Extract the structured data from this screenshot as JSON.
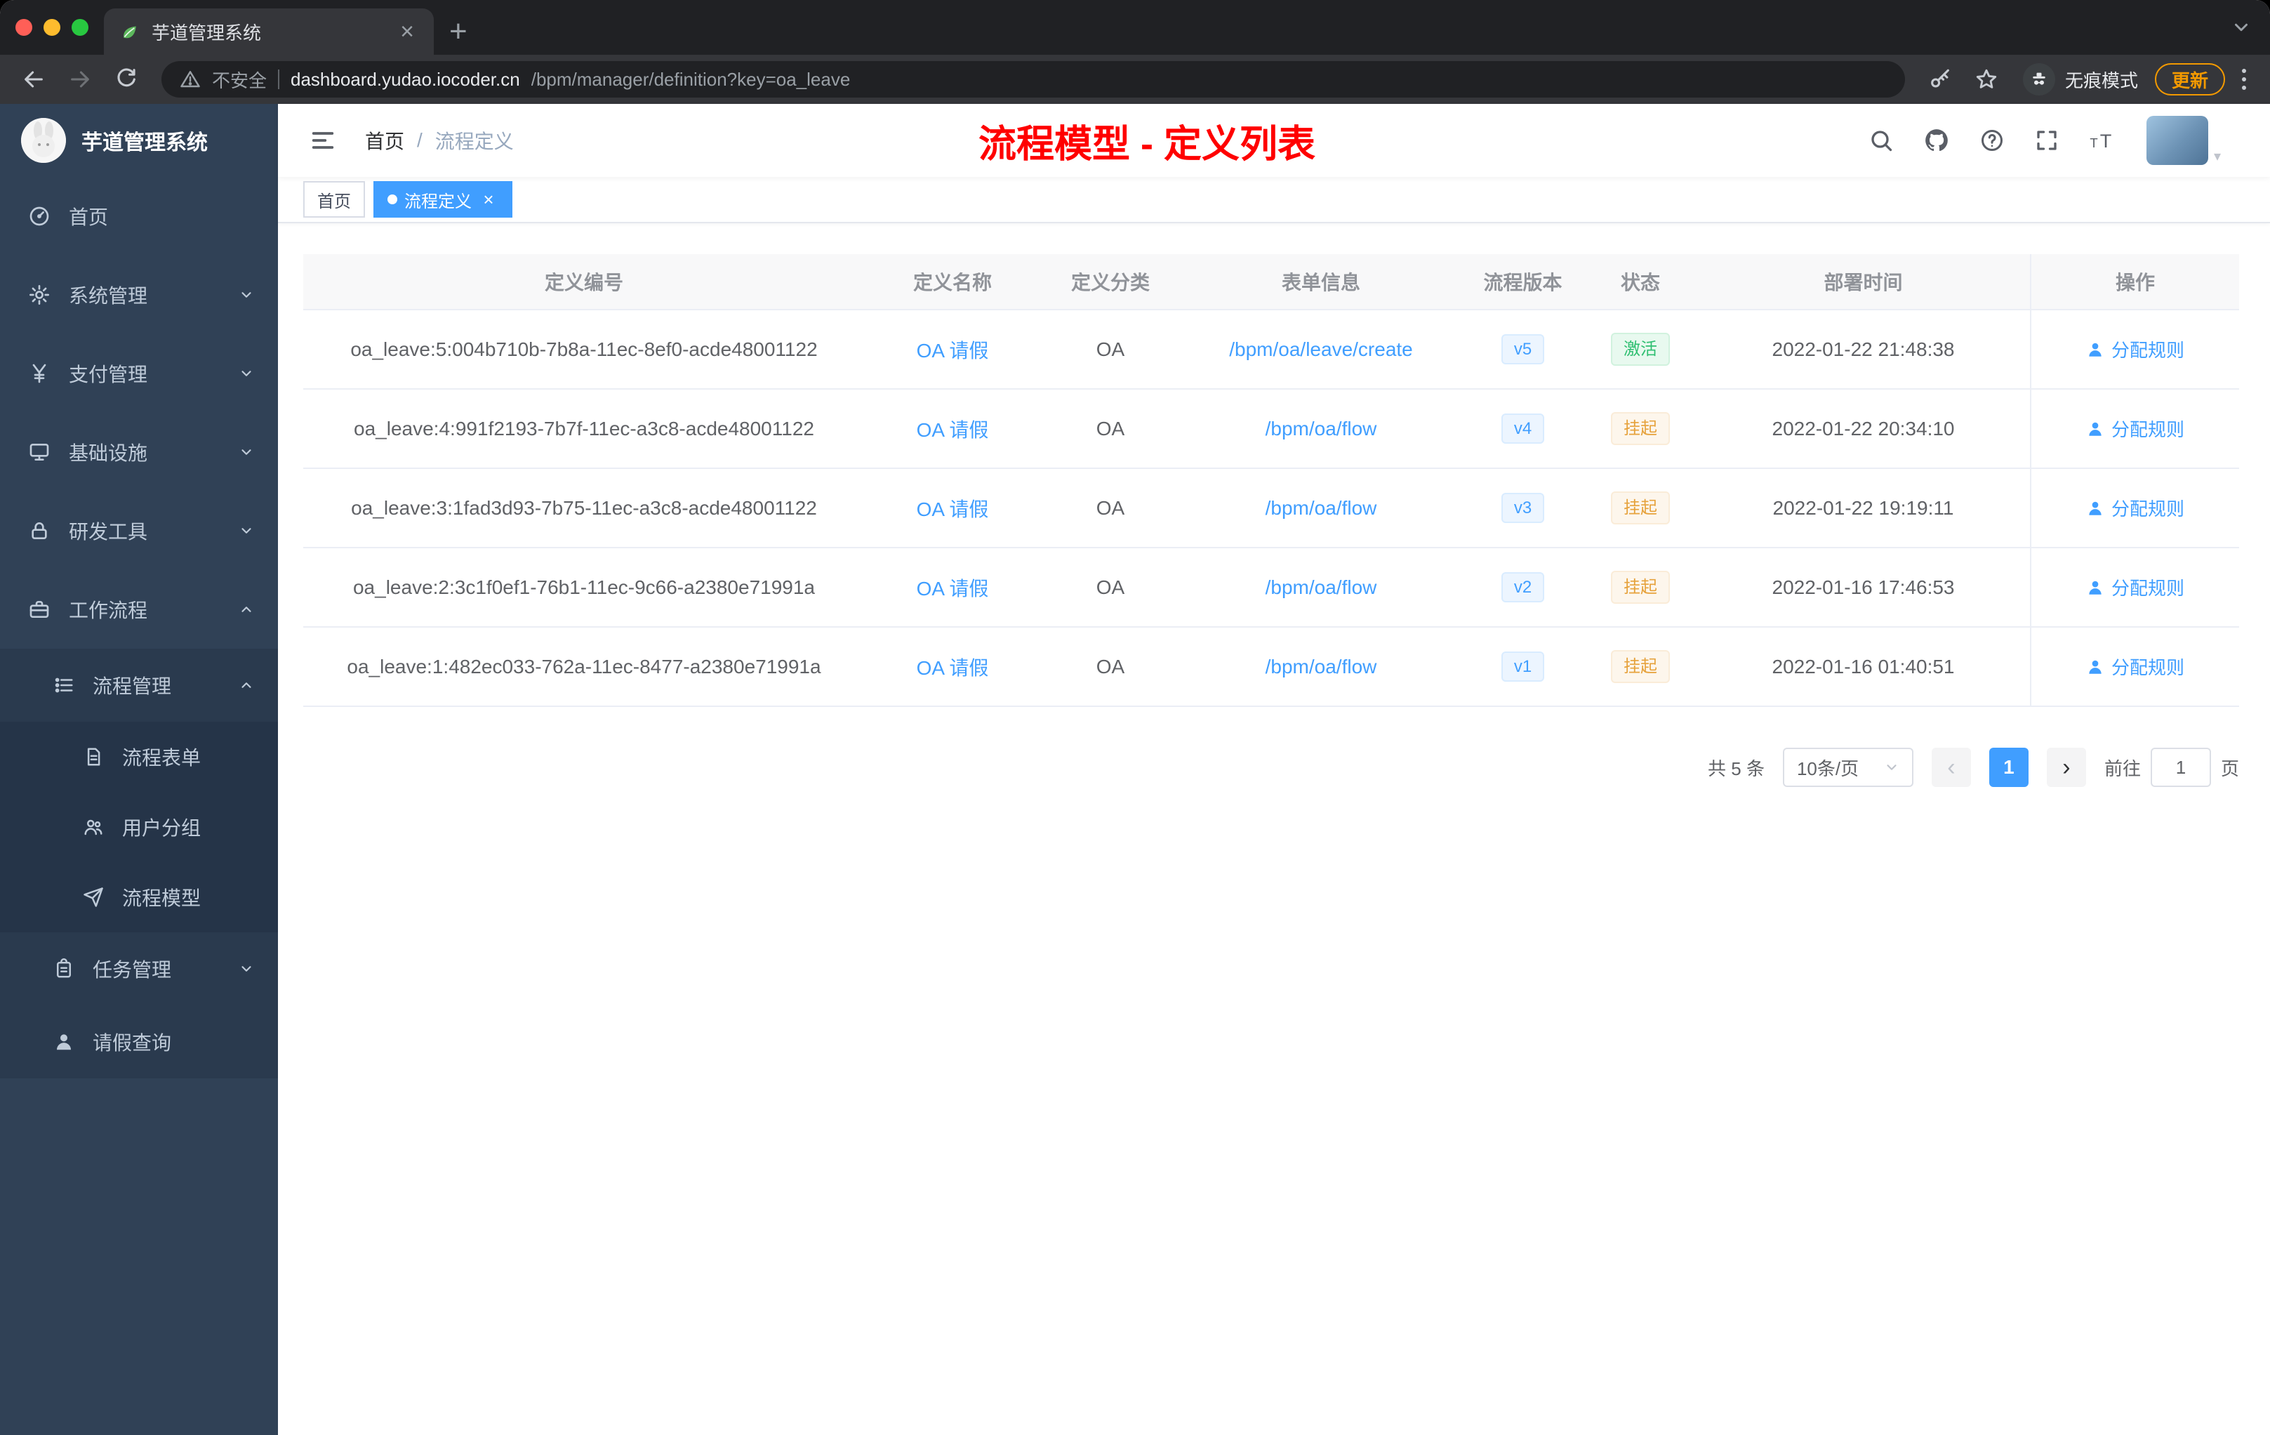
{
  "browser": {
    "tab_title": "芋道管理系统",
    "security_label": "不安全",
    "url_host": "dashboard.yudao.iocoder.cn",
    "url_path": "/bpm/manager/definition?key=oa_leave",
    "incognito_label": "无痕模式",
    "update_label": "更新"
  },
  "sidebar": {
    "logo_title": "芋道管理系统",
    "items": [
      {
        "label": "首页"
      },
      {
        "label": "系统管理"
      },
      {
        "label": "支付管理"
      },
      {
        "label": "基础设施"
      },
      {
        "label": "研发工具"
      },
      {
        "label": "工作流程"
      },
      {
        "label": "流程管理"
      },
      {
        "label": "流程表单"
      },
      {
        "label": "用户分组"
      },
      {
        "label": "流程模型"
      },
      {
        "label": "任务管理"
      },
      {
        "label": "请假查询"
      }
    ]
  },
  "header": {
    "breadcrumb_home": "首页",
    "breadcrumb_sep": "/",
    "breadcrumb_current": "流程定义",
    "annotation": "流程模型 - 定义列表"
  },
  "tags": {
    "home": "首页",
    "active": "流程定义"
  },
  "table": {
    "columns": [
      "定义编号",
      "定义名称",
      "定义分类",
      "表单信息",
      "流程版本",
      "状态",
      "部署时间",
      "操作"
    ],
    "rows": [
      {
        "id": "oa_leave:5:004b710b-7b8a-11ec-8ef0-acde48001122",
        "name": "OA 请假",
        "category": "OA",
        "form": "/bpm/oa/leave/create",
        "version": "v5",
        "status": "激活",
        "time": "2022-01-22 21:48:38",
        "action": "分配规则"
      },
      {
        "id": "oa_leave:4:991f2193-7b7f-11ec-a3c8-acde48001122",
        "name": "OA 请假",
        "category": "OA",
        "form": "/bpm/oa/flow",
        "version": "v4",
        "status": "挂起",
        "time": "2022-01-22 20:34:10",
        "action": "分配规则"
      },
      {
        "id": "oa_leave:3:1fad3d93-7b75-11ec-a3c8-acde48001122",
        "name": "OA 请假",
        "category": "OA",
        "form": "/bpm/oa/flow",
        "version": "v3",
        "status": "挂起",
        "time": "2022-01-22 19:19:11",
        "action": "分配规则"
      },
      {
        "id": "oa_leave:2:3c1f0ef1-76b1-11ec-9c66-a2380e71991a",
        "name": "OA 请假",
        "category": "OA",
        "form": "/bpm/oa/flow",
        "version": "v2",
        "status": "挂起",
        "time": "2022-01-16 17:46:53",
        "action": "分配规则"
      },
      {
        "id": "oa_leave:1:482ec033-762a-11ec-8477-a2380e71991a",
        "name": "OA 请假",
        "category": "OA",
        "form": "/bpm/oa/flow",
        "version": "v1",
        "status": "挂起",
        "time": "2022-01-16 01:40:51",
        "action": "分配规则"
      }
    ]
  },
  "pagination": {
    "total": "共 5 条",
    "page_size": "10条/页",
    "current_page": "1",
    "goto_label": "前往",
    "goto_value": "1",
    "page_unit": "页"
  },
  "colors": {
    "accent": "#409eff",
    "annotation_red": "#ff0000",
    "success_green": "#2fbf71",
    "warning_orange": "#e6a23c",
    "sidebar_bg": "#304156"
  }
}
